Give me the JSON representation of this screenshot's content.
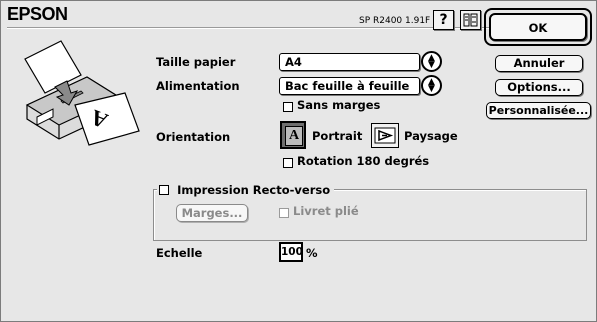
{
  "header": {
    "brand": "EPSON",
    "version": "SP R2400 1.91F",
    "help_label": "?",
    "ok_label": "OK"
  },
  "buttons": {
    "annuler": "Annuler",
    "options": "Options...",
    "personnalisee": "Personnalisée...",
    "marges": "Marges..."
  },
  "paper": {
    "size_label": "Taille papier",
    "size_value": "A4",
    "source_label": "Alimentation",
    "source_value": "Bac feuille à feuille",
    "borderless_label": "Sans marges",
    "borderless_checked": false
  },
  "orientation": {
    "label": "Orientation",
    "portrait": "Portrait",
    "landscape": "Paysage",
    "portrait_icon_letter": "A",
    "selected": "portrait",
    "rotate_label": "Rotation 180 degrés",
    "rotate_checked": false
  },
  "duplex": {
    "label": "Impression Recto-verso",
    "checked": false,
    "booklet_label": "Livret plié",
    "booklet_checked": false
  },
  "scale": {
    "label": "Echelle",
    "value": "100",
    "unit": "%"
  },
  "colors": {
    "dialog_bg": "#e7e7e7",
    "border": "#000000",
    "disabled_text": "#8a8a8a"
  }
}
